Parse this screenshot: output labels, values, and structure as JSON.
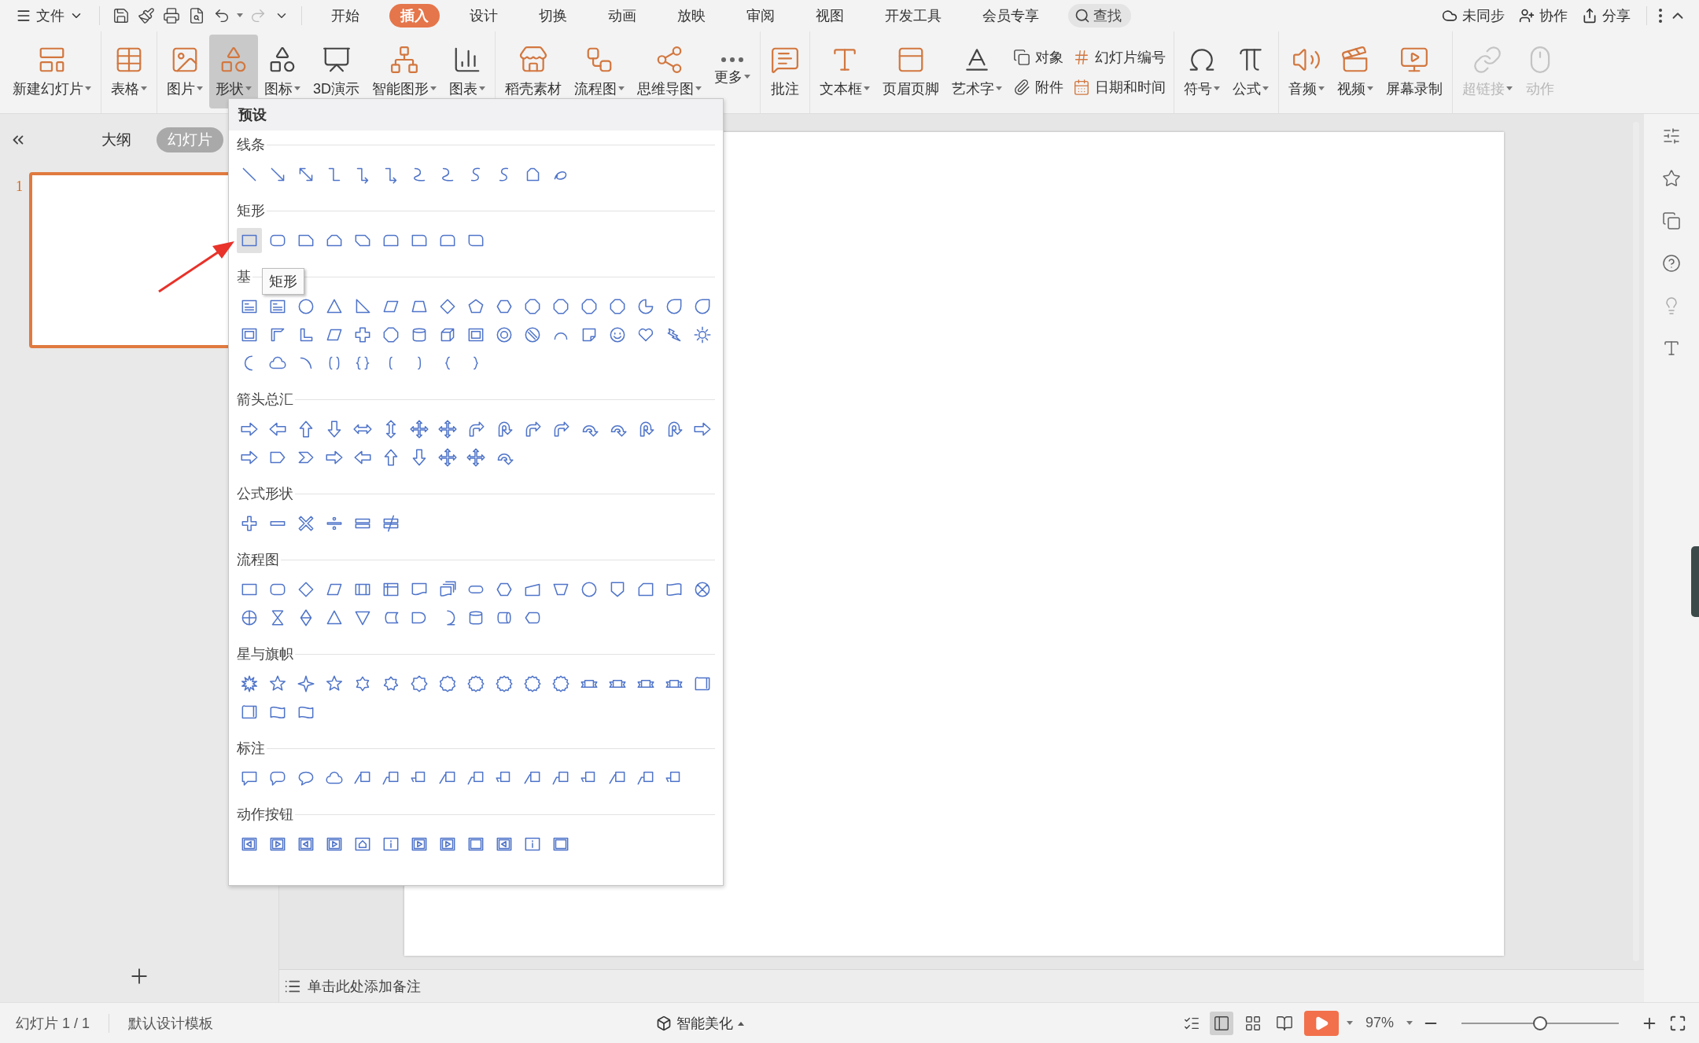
{
  "menu_bar": {
    "file_label": "文件",
    "tabs": [
      {
        "label": "开始",
        "selected": false
      },
      {
        "label": "插入",
        "selected": true
      },
      {
        "label": "设计",
        "selected": false
      },
      {
        "label": "切换",
        "selected": false
      },
      {
        "label": "动画",
        "selected": false
      },
      {
        "label": "放映",
        "selected": false
      },
      {
        "label": "审阅",
        "selected": false
      },
      {
        "label": "视图",
        "selected": false
      },
      {
        "label": "开发工具",
        "selected": false
      },
      {
        "label": "会员专享",
        "selected": false
      }
    ],
    "search_label": "查找",
    "actions": [
      "未同步",
      "协作",
      "分享"
    ]
  },
  "ribbon": {
    "groups": [
      {
        "items": [
          {
            "kind": "large",
            "label": "新建幻灯片",
            "dropdown": true,
            "pressed": false,
            "disabled": false
          }
        ]
      },
      {
        "items": [
          {
            "kind": "large",
            "label": "表格",
            "dropdown": true,
            "pressed": false,
            "disabled": false
          }
        ]
      },
      {
        "items": [
          {
            "kind": "large",
            "label": "图片",
            "dropdown": true,
            "pressed": false,
            "disabled": false
          },
          {
            "kind": "large",
            "label": "形状",
            "dropdown": true,
            "pressed": true,
            "disabled": false
          },
          {
            "kind": "large",
            "label": "图标",
            "dropdown": true,
            "pressed": false,
            "disabled": false
          },
          {
            "kind": "large",
            "label": "3D演示",
            "dropdown": false,
            "pressed": false,
            "disabled": false
          },
          {
            "kind": "large",
            "label": "智能图形",
            "dropdown": true,
            "pressed": false,
            "disabled": false
          },
          {
            "kind": "large",
            "label": "图表",
            "dropdown": true,
            "pressed": false,
            "disabled": false
          }
        ]
      },
      {
        "items": [
          {
            "kind": "large",
            "label": "稻壳素材",
            "dropdown": false,
            "pressed": false,
            "disabled": false
          },
          {
            "kind": "large",
            "label": "流程图",
            "dropdown": true,
            "pressed": false,
            "disabled": false
          },
          {
            "kind": "large",
            "label": "思维导图",
            "dropdown": true,
            "pressed": false,
            "disabled": false
          },
          {
            "kind": "large",
            "label": "更多",
            "dropdown": true,
            "pressed": false,
            "disabled": false
          }
        ]
      },
      {
        "items": [
          {
            "kind": "large",
            "label": "批注",
            "dropdown": false,
            "pressed": false,
            "disabled": false
          }
        ]
      },
      {
        "items": [
          {
            "kind": "large",
            "label": "文本框",
            "dropdown": true,
            "pressed": false,
            "disabled": false
          },
          {
            "kind": "large",
            "label": "页眉页脚",
            "dropdown": false,
            "pressed": false,
            "disabled": false
          },
          {
            "kind": "large",
            "label": "艺术字",
            "dropdown": true,
            "pressed": false,
            "disabled": false
          },
          {
            "kind": "stack",
            "items": [
              {
                "label": "对象"
              },
              {
                "label": "附件"
              }
            ]
          },
          {
            "kind": "stack",
            "items": [
              {
                "label": "幻灯片编号"
              },
              {
                "label": "日期和时间"
              }
            ]
          }
        ]
      },
      {
        "items": [
          {
            "kind": "large",
            "label": "符号",
            "dropdown": true,
            "pressed": false,
            "disabled": false
          },
          {
            "kind": "large",
            "label": "公式",
            "dropdown": true,
            "pressed": false,
            "disabled": false
          }
        ]
      },
      {
        "items": [
          {
            "kind": "large",
            "label": "音频",
            "dropdown": true,
            "pressed": false,
            "disabled": false
          },
          {
            "kind": "large",
            "label": "视频",
            "dropdown": true,
            "pressed": false,
            "disabled": false
          },
          {
            "kind": "large",
            "label": "屏幕录制",
            "dropdown": false,
            "pressed": false,
            "disabled": false
          }
        ]
      },
      {
        "items": [
          {
            "kind": "large",
            "label": "超链接",
            "dropdown": true,
            "pressed": false,
            "disabled": true
          },
          {
            "kind": "large",
            "label": "动作",
            "dropdown": false,
            "pressed": false,
            "disabled": true
          }
        ]
      }
    ]
  },
  "slide_panel": {
    "tabs": [
      {
        "label": "大纲",
        "selected": false
      },
      {
        "label": "幻灯片",
        "selected": true
      }
    ],
    "slides": [
      {
        "number": "1",
        "selected": true
      }
    ]
  },
  "shape_panel": {
    "header": "预设",
    "tooltip": "矩形",
    "sections": [
      {
        "title": "线条",
        "shapes": [
          {
            "selected": false
          },
          {
            "selected": false
          },
          {
            "selected": false
          },
          {
            "selected": false
          },
          {
            "selected": false
          },
          {
            "selected": false
          },
          {
            "selected": false
          },
          {
            "selected": false
          },
          {
            "selected": false
          },
          {
            "selected": false
          },
          {
            "selected": false
          },
          {
            "selected": false
          }
        ]
      },
      {
        "title": "矩形",
        "shapes": [
          {
            "selected": true
          },
          {
            "selected": false
          },
          {
            "selected": false
          },
          {
            "selected": false
          },
          {
            "selected": false
          },
          {
            "selected": false
          },
          {
            "selected": false
          },
          {
            "selected": false
          },
          {
            "selected": false
          }
        ]
      },
      {
        "title": "基",
        "shapes": [
          {
            "selected": false
          },
          {
            "selected": false
          },
          {
            "selected": false
          },
          {
            "selected": false
          },
          {
            "selected": false
          },
          {
            "selected": false
          },
          {
            "selected": false
          },
          {
            "selected": false
          },
          {
            "selected": false
          },
          {
            "selected": false
          },
          {
            "selected": false
          },
          {
            "selected": false
          },
          {
            "selected": false
          },
          {
            "selected": false
          },
          {
            "selected": false
          },
          {
            "selected": false
          },
          {
            "selected": false
          },
          {
            "selected": false
          },
          {
            "selected": false
          },
          {
            "selected": false
          },
          {
            "selected": false
          },
          {
            "selected": false
          },
          {
            "selected": false
          },
          {
            "selected": false
          },
          {
            "selected": false
          },
          {
            "selected": false
          },
          {
            "selected": false
          },
          {
            "selected": false
          },
          {
            "selected": false
          },
          {
            "selected": false
          },
          {
            "selected": false
          },
          {
            "selected": false
          },
          {
            "selected": false
          },
          {
            "selected": false
          },
          {
            "selected": false
          },
          {
            "selected": false
          },
          {
            "selected": false
          },
          {
            "selected": false
          },
          {
            "selected": false
          },
          {
            "selected": false
          },
          {
            "selected": false
          },
          {
            "selected": false
          },
          {
            "selected": false
          }
        ]
      },
      {
        "title": "箭头总汇",
        "shapes": [
          {
            "selected": false
          },
          {
            "selected": false
          },
          {
            "selected": false
          },
          {
            "selected": false
          },
          {
            "selected": false
          },
          {
            "selected": false
          },
          {
            "selected": false
          },
          {
            "selected": false
          },
          {
            "selected": false
          },
          {
            "selected": false
          },
          {
            "selected": false
          },
          {
            "selected": false
          },
          {
            "selected": false
          },
          {
            "selected": false
          },
          {
            "selected": false
          },
          {
            "selected": false
          },
          {
            "selected": false
          },
          {
            "selected": false
          },
          {
            "selected": false
          },
          {
            "selected": false
          },
          {
            "selected": false
          },
          {
            "selected": false
          },
          {
            "selected": false
          },
          {
            "selected": false
          },
          {
            "selected": false
          },
          {
            "selected": false
          },
          {
            "selected": false
          }
        ]
      },
      {
        "title": "公式形状",
        "shapes": [
          {
            "selected": false
          },
          {
            "selected": false
          },
          {
            "selected": false
          },
          {
            "selected": false
          },
          {
            "selected": false
          },
          {
            "selected": false
          }
        ]
      },
      {
        "title": "流程图",
        "shapes": [
          {
            "selected": false
          },
          {
            "selected": false
          },
          {
            "selected": false
          },
          {
            "selected": false
          },
          {
            "selected": false
          },
          {
            "selected": false
          },
          {
            "selected": false
          },
          {
            "selected": false
          },
          {
            "selected": false
          },
          {
            "selected": false
          },
          {
            "selected": false
          },
          {
            "selected": false
          },
          {
            "selected": false
          },
          {
            "selected": false
          },
          {
            "selected": false
          },
          {
            "selected": false
          },
          {
            "selected": false
          },
          {
            "selected": false
          },
          {
            "selected": false
          },
          {
            "selected": false
          },
          {
            "selected": false
          },
          {
            "selected": false
          },
          {
            "selected": false
          },
          {
            "selected": false
          },
          {
            "selected": false
          },
          {
            "selected": false
          },
          {
            "selected": false
          },
          {
            "selected": false
          }
        ]
      },
      {
        "title": "星与旗帜",
        "shapes": [
          {
            "selected": false
          },
          {
            "selected": false
          },
          {
            "selected": false
          },
          {
            "selected": false
          },
          {
            "selected": false
          },
          {
            "selected": false
          },
          {
            "selected": false
          },
          {
            "selected": false
          },
          {
            "selected": false
          },
          {
            "selected": false
          },
          {
            "selected": false
          },
          {
            "selected": false
          },
          {
            "selected": false
          },
          {
            "selected": false
          },
          {
            "selected": false
          },
          {
            "selected": false
          },
          {
            "selected": false
          },
          {
            "selected": false
          },
          {
            "selected": false
          },
          {
            "selected": false
          }
        ]
      },
      {
        "title": "标注",
        "shapes": [
          {
            "selected": false
          },
          {
            "selected": false
          },
          {
            "selected": false
          },
          {
            "selected": false
          },
          {
            "selected": false
          },
          {
            "selected": false
          },
          {
            "selected": false
          },
          {
            "selected": false
          },
          {
            "selected": false
          },
          {
            "selected": false
          },
          {
            "selected": false
          },
          {
            "selected": false
          },
          {
            "selected": false
          },
          {
            "selected": false
          },
          {
            "selected": false
          },
          {
            "selected": false
          }
        ]
      },
      {
        "title": "动作按钮",
        "shapes": [
          {
            "selected": false
          },
          {
            "selected": false
          },
          {
            "selected": false
          },
          {
            "selected": false
          },
          {
            "selected": false
          },
          {
            "selected": false
          },
          {
            "selected": false
          },
          {
            "selected": false
          },
          {
            "selected": false
          },
          {
            "selected": false
          },
          {
            "selected": false
          },
          {
            "selected": false
          }
        ]
      }
    ]
  },
  "notes_placeholder": "单击此处添加备注",
  "status_bar": {
    "slide_count": "幻灯片 1 / 1",
    "template": "默认设计模板",
    "beautify": "智能美化",
    "views": [
      {
        "selected": true
      },
      {
        "selected": false
      },
      {
        "selected": false
      }
    ],
    "zoom": "97%",
    "zoom_slider": {
      "level": 0.5
    }
  }
}
